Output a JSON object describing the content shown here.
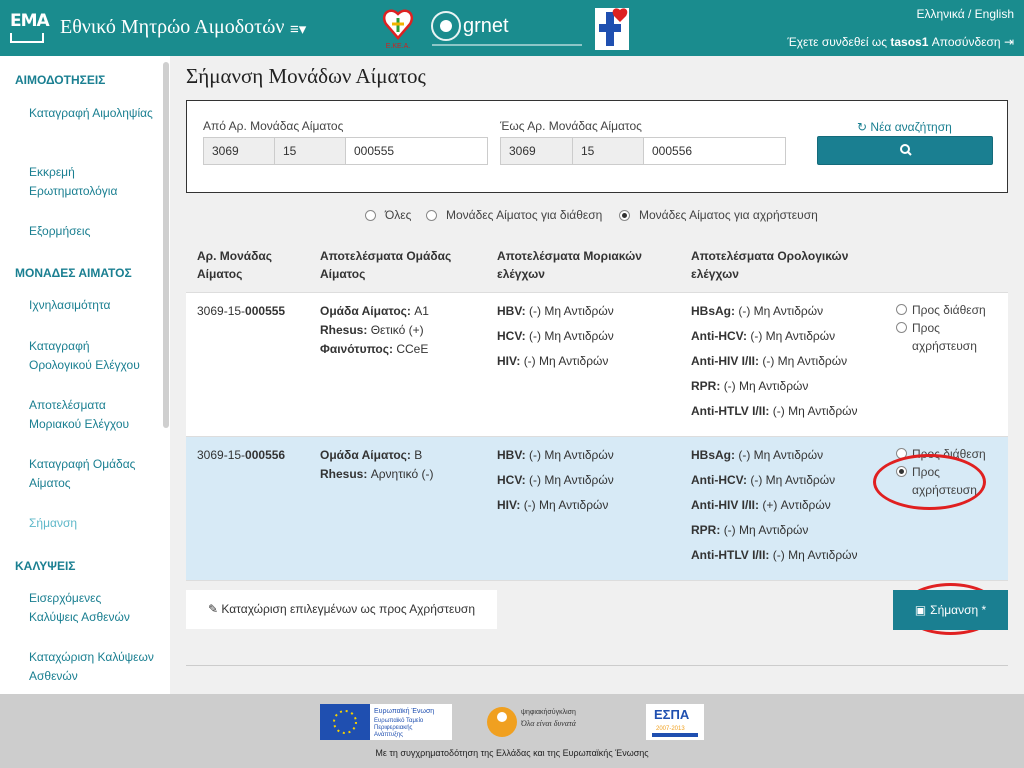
{
  "header": {
    "logo_text": "EMA",
    "title": "Εθνικό Μητρώο Αιμοδοτών",
    "lang": "Ελληνικά / English",
    "logged_in_prefix": "Έχετε συνδεθεί ως",
    "username": "tasos1",
    "logout": "Αποσύνδεση",
    "partner_logos": {
      "ekea": "Ε.ΚΕ.Α.",
      "grnet": "grnet"
    }
  },
  "sidebar": {
    "sections": [
      {
        "title": "ΑΙΜΟΔΟΤΗΣΕΙΣ",
        "items": [
          "Καταγραφή Αιμοληψίας",
          "Εκκρεμή Ερωτηματολόγια",
          "Εξορμήσεις"
        ]
      },
      {
        "title": "ΜΟΝΑΔΕΣ ΑΙΜΑΤΟΣ",
        "items": [
          "Ιχνηλασιμότητα",
          "Καταγραφή Ορολογικού Ελέγχου",
          "Αποτελέσματα Μοριακού Ελέγχου",
          "Καταγραφή Ομάδας Αίματος",
          "Σήμανση"
        ]
      },
      {
        "title": "ΚΑΛΥΨΕΙΣ",
        "items": [
          "Εισερχόμενες Καλύψεις Ασθενών",
          "Καταχώριση Καλύψεων Ασθενών"
        ]
      }
    ],
    "active_item": "Σήμανση"
  },
  "page": {
    "title": "Σήμανση Μονάδων Αίματος"
  },
  "search": {
    "from_label": "Από Αρ. Μονάδας Αίματος",
    "from": [
      "3069",
      "15",
      "000555"
    ],
    "to_label": "Έως Αρ. Μονάδας Αίματος",
    "to": [
      "3069",
      "15",
      "000556"
    ],
    "new_search": "Νέα αναζήτηση",
    "search_icon": "search-icon"
  },
  "filters": {
    "options": [
      "Όλες",
      "Μονάδες Αίματος για διάθεση",
      "Μονάδες Αίματος για αχρήστευση"
    ],
    "selected": 2
  },
  "table": {
    "headers": [
      "Αρ. Μονάδας Αίματος",
      "Αποτελέσματα Ομάδας Αίματος",
      "Αποτελέσματα Μοριακών ελέγχων",
      "Αποτελέσματα Ορολογικών ελέγχων"
    ],
    "rows": [
      {
        "unit_prefix": "3069-15-",
        "unit_suffix": "000555",
        "blood": [
          [
            "Ομάδα Αίματος:",
            "A1"
          ],
          [
            "Rhesus:",
            "Θετικό (+)"
          ],
          [
            "Φαινότυπος:",
            "CCeE"
          ]
        ],
        "molecular": [
          [
            "HBV:",
            "(-) Μη Αντιδρών"
          ],
          [
            "HCV:",
            "(-) Μη Αντιδρών"
          ],
          [
            "HIV:",
            "(-) Μη Αντιδρών"
          ]
        ],
        "serology": [
          [
            "HBsAg:",
            "(-) Μη Αντιδρών"
          ],
          [
            "Anti-HCV:",
            "(-) Μη Αντιδρών"
          ],
          [
            "Anti-HIV I/II:",
            "(-) Μη Αντιδρών"
          ],
          [
            "RPR:",
            "(-) Μη Αντιδρών"
          ],
          [
            "Anti-HTLV I/II:",
            "(-) Μη Αντιδρών"
          ]
        ],
        "options": [
          "Προς διάθεση",
          "Προς αχρήστευση"
        ],
        "selected": -1,
        "highlight": false
      },
      {
        "unit_prefix": "3069-15-",
        "unit_suffix": "000556",
        "blood": [
          [
            "Ομάδα Αίματος:",
            "B"
          ],
          [
            "Rhesus:",
            "Αρνητικό (-)"
          ]
        ],
        "molecular": [
          [
            "HBV:",
            "(-) Μη Αντιδρών"
          ],
          [
            "HCV:",
            "(-) Μη Αντιδρών"
          ],
          [
            "HIV:",
            "(-) Μη Αντιδρών"
          ]
        ],
        "serology": [
          [
            "HBsAg:",
            "(-) Μη Αντιδρών"
          ],
          [
            "Anti-HCV:",
            "(-) Μη Αντιδρών"
          ],
          [
            "Anti-HIV I/II:",
            "(+) Αντιδρών"
          ],
          [
            "RPR:",
            "(-) Μη Αντιδρών"
          ],
          [
            "Anti-HTLV I/II:",
            "(-) Μη Αντιδρών"
          ]
        ],
        "options": [
          "Προς διάθεση",
          "Προς αχρήστευση"
        ],
        "selected": 1,
        "highlight": true
      }
    ]
  },
  "actions": {
    "register_selected": "Καταχώριση επιλεγμένων ως προς Αχρήστευση",
    "mark": "Σήμανση *"
  },
  "colors": {
    "header_bg": "#1a8c8e",
    "accent": "#1a7f91",
    "row_highlight": "#d7eaf6",
    "annotation": "#e02020"
  },
  "footer": {
    "eu_text": [
      "Ευρωπαϊκή Ένωση",
      "Ευρωπαϊκό Ταμείο",
      "Περιφερειακής",
      "Ανάπτυξης"
    ],
    "digital_text": [
      "ψηφιακήσύγκλιση",
      "Όλα είναι δυνατά"
    ],
    "espa_text": [
      "ΕΣΠΑ",
      "2007-2013"
    ],
    "cofunding": "Με τη συγχρηματοδότηση της Ελλάδας και της Ευρωπαϊκής Ένωσης"
  }
}
